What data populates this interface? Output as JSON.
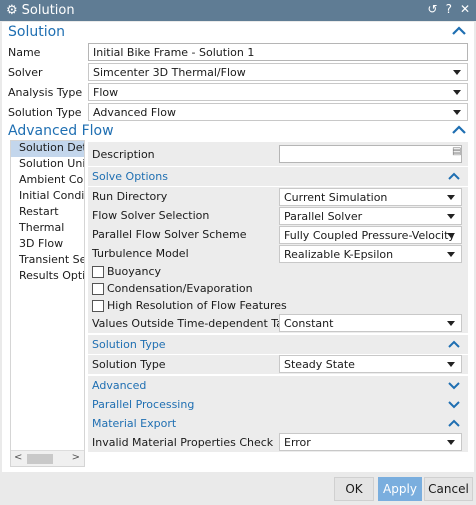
{
  "window": {
    "title": "Solution"
  },
  "solution_section": {
    "title": "Solution",
    "fields": [
      {
        "label": "Name",
        "value": "Initial Bike Frame - Solution 1"
      },
      {
        "label": "Solver",
        "value": "Simcenter 3D Thermal/Flow"
      },
      {
        "label": "Analysis Type",
        "value": "Flow"
      },
      {
        "label": "Solution Type",
        "value": "Advanced Flow"
      }
    ]
  },
  "advanced_flow": {
    "title": "Advanced Flow",
    "nav_items": [
      "Solution Deta",
      "Solution Units",
      "Ambient Conc",
      "Initial Conditi",
      "Restart",
      "Thermal",
      "3D Flow",
      "Transient Setu",
      "Results Option"
    ],
    "description_label": "Description",
    "description_value": "",
    "solve_options_title": "Solve Options",
    "run_directory": {
      "label": "Run Directory",
      "value": "Current Simulation"
    },
    "flow_solver_selection": {
      "label": "Flow Solver Selection",
      "value": "Parallel Solver"
    },
    "parallel_scheme": {
      "label": "Parallel Flow Solver Scheme",
      "value": "Fully Coupled Pressure-Velocity"
    },
    "turbulence_model": {
      "label": "Turbulence Model",
      "value": "Realizable K-Epsilon"
    },
    "checkboxes": [
      "Buoyancy",
      "Condensation/Evaporation",
      "High Resolution of Flow Features"
    ],
    "values_outside": {
      "label": "Values Outside Time-dependent Tables",
      "value": "Constant"
    },
    "solution_type_title": "Solution Type",
    "solution_type": {
      "label": "Solution Type",
      "value": "Steady State"
    },
    "advanced_title": "Advanced",
    "parallel_processing_title": "Parallel Processing",
    "material_export_title": "Material Export",
    "invalid_material": {
      "label": "Invalid Material Properties Check",
      "value": "Error"
    }
  },
  "buttons": {
    "ok": "OK",
    "apply": "Apply",
    "cancel": "Cancel"
  },
  "colors": {
    "titlebar": "#5f7c94",
    "accent": "#1f6fb2",
    "apply": "#7aaede"
  }
}
